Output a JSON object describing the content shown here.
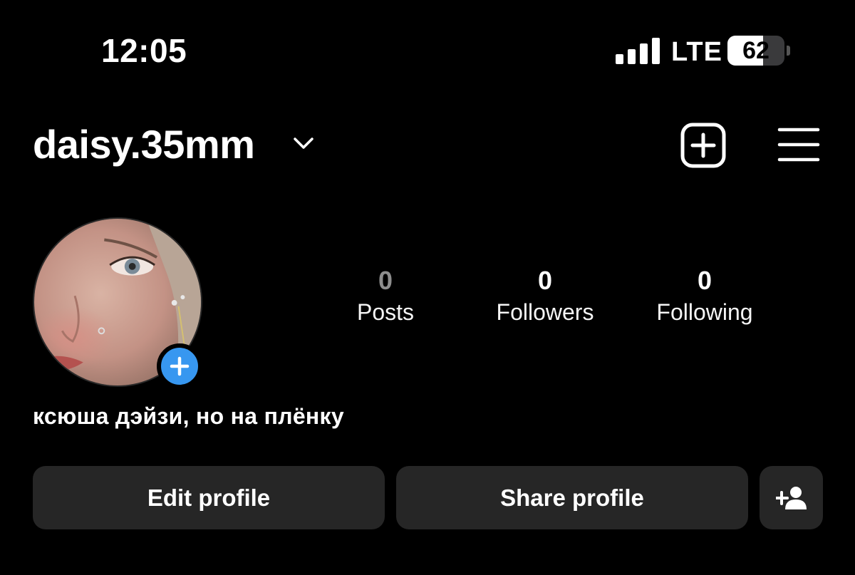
{
  "status_bar": {
    "time": "12:05",
    "network": "LTE",
    "battery_level": "62",
    "battery_fraction": 0.62
  },
  "header": {
    "username": "daisy.35mm",
    "icons": [
      "chevron-down-icon",
      "create-post-icon",
      "menu-icon"
    ]
  },
  "profile": {
    "avatar_icon": "profile-photo",
    "add_story_icon": "plus-icon",
    "bio": "ксюша дэйзи, но на плёнку"
  },
  "stats": {
    "posts": {
      "value": "0",
      "label": "Posts"
    },
    "followers": {
      "value": "0",
      "label": "Followers"
    },
    "following": {
      "value": "0",
      "label": "Following"
    }
  },
  "actions": {
    "edit_label": "Edit profile",
    "share_label": "Share profile",
    "discover_icon": "add-person-icon"
  },
  "colors": {
    "background": "#000000",
    "button": "#262626",
    "accent": "#3797f0",
    "muted": "#8e8e8e"
  }
}
